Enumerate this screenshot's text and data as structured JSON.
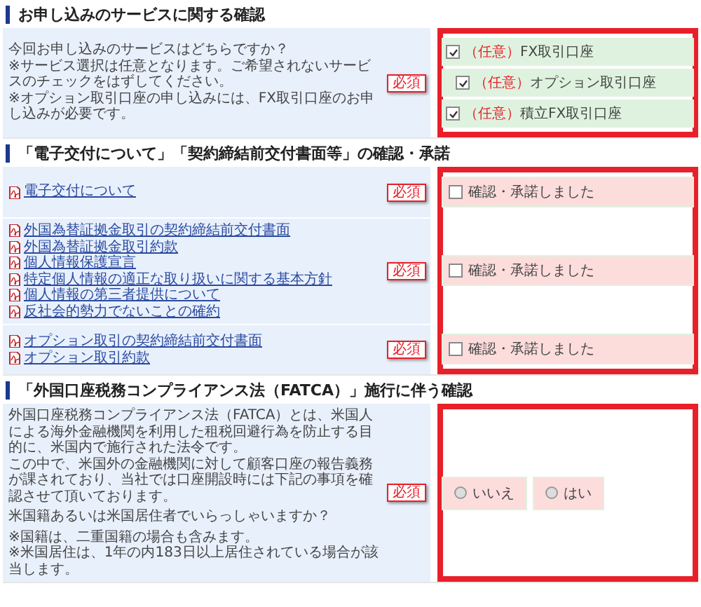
{
  "sections": [
    {
      "kind": "services",
      "title": "お申し込みのサービスに関する確認",
      "highlighted": true,
      "question": "今回お申し込みのサービスはどちらですか？",
      "notes": [
        "※サービス選択は任意となります。ご希望されないサービスのチェックをはずしてください。",
        "※オプション取引口座の申し込みには、FX取引口座のお申し込みが必要です。"
      ],
      "required": "必須",
      "options": [
        {
          "prefix": "（任意）",
          "label": "FX取引口座",
          "checked": true,
          "indented": false
        },
        {
          "prefix": "（任意）",
          "label": "オプション取引口座",
          "checked": true,
          "indented": true
        },
        {
          "prefix": "（任意）",
          "label": "積立FX取引口座",
          "checked": true,
          "indented": false
        }
      ]
    },
    {
      "kind": "documents",
      "title": "「電子交付について」「契約締結前交付書面等」の確認・承諾",
      "highlighted": true,
      "groups": [
        {
          "links": [
            "電子交付について"
          ],
          "required": "必須",
          "confirm": {
            "label": "確認・承諾しました",
            "checked": false
          }
        },
        {
          "links": [
            "外国為替証拠金取引の契約締結前交付書面",
            "外国為替証拠金取引約款",
            "個人情報保護宣言",
            "特定個人情報の適正な取り扱いに関する基本方針",
            "個人情報の第三者提供について",
            "反社会的勢力でないことの確約"
          ],
          "required": "必須",
          "confirm": {
            "label": "確認・承諾しました",
            "checked": false
          }
        },
        {
          "links": [
            "オプション取引の契約締結前交付書面",
            "オプション取引約款"
          ],
          "required": "必須",
          "confirm": {
            "label": "確認・承諾しました",
            "checked": false
          }
        }
      ]
    },
    {
      "kind": "fatca",
      "title": "「外国口座税務コンプライアンス法（FATCA）」施行に伴う確認",
      "highlighted": true,
      "paragraphs": [
        "外国口座税務コンプライアンス法（FATCA）とは、米国人による海外金融機関を利用した租税回避行為を防止する目的に、米国内で施行された法令です。",
        "この中で、米国外の金融機関に対して顧客口座の報告義務が課されており、当社では口座開設時には下記の事項を確認させて頂いております。"
      ],
      "question": "米国籍あるいは米国居住者でいらっしゃいますか？",
      "notes": [
        "※国籍は、二重国籍の場合も含みます。",
        "※米国居住は、1年の内183日以上居住されている場合が該当します。"
      ],
      "required": "必須",
      "choices": [
        {
          "label": "いいえ",
          "selected": false
        },
        {
          "label": "はい",
          "selected": false
        }
      ]
    }
  ]
}
